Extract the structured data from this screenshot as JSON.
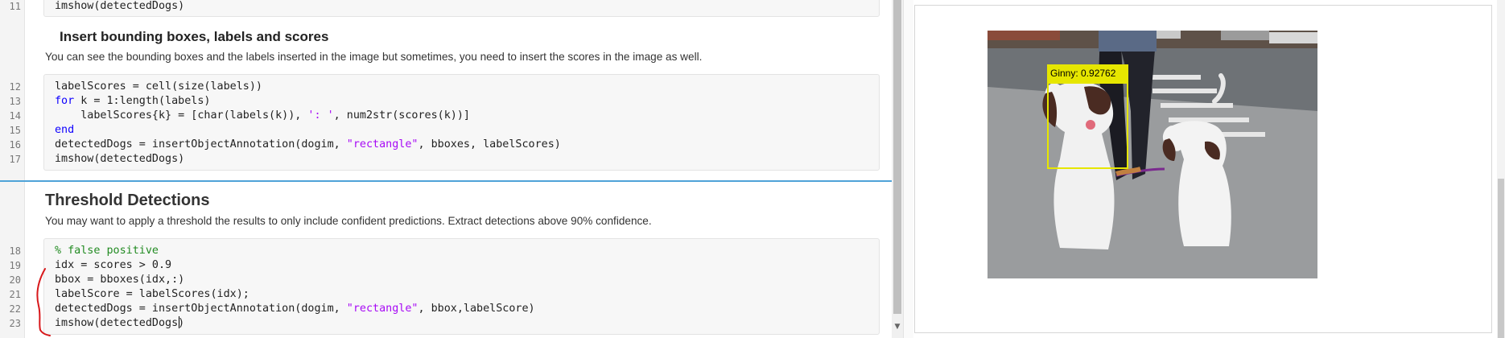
{
  "gutter": {
    "line_numbers": [
      "11",
      "12",
      "13",
      "14",
      "15",
      "16",
      "17",
      "18",
      "19",
      "20",
      "21",
      "22",
      "23"
    ]
  },
  "section1": {
    "code_top": "imshow(detectedDogs)",
    "heading": "Insert bounding boxes, labels and scores",
    "paragraph": "You can see the bounding boxes and the labels inserted in the image but sometimes, you need to insert the scores in the image as well.",
    "code": {
      "line12": "labelScores = cell(size(labels))",
      "line13_kw": "for",
      "line13_rest": " k = 1:length(labels)",
      "line14_a": "    labelScores{k} = [char(labels(k)), ",
      "line14_str": "': '",
      "line14_b": ", num2str(scores(k))]",
      "line15_kw": "end",
      "line16_a": "detectedDogs = insertObjectAnnotation(dogim, ",
      "line16_str": "\"rectangle\"",
      "line16_b": ", bboxes, labelScores)",
      "line17": "imshow(detectedDogs)"
    }
  },
  "section2": {
    "heading": "Threshold Detections",
    "paragraph": "You may want to apply a threshold the results to only include confident predictions. Extract detections above 90% confidence.",
    "code": {
      "line18": "% false positive",
      "line19": "idx = scores > 0.9",
      "line20": "bbox = bboxes(idx,:)",
      "line21": "labelScore = labelScores(idx);",
      "line22_a": "detectedDogs = insertObjectAnnotation(dogim, ",
      "line22_str": "\"rectangle\"",
      "line22_b": ", bbox,labelScore)",
      "line23": "imshow(detectedDogs)"
    }
  },
  "output": {
    "annotation_label": "Ginny: 0.92762",
    "annotation_color": "#e6e600"
  },
  "colors": {
    "keyword": "#0e00ff",
    "string": "#a709f5",
    "comment": "#228b22",
    "section_divider": "#4fa3d8"
  }
}
